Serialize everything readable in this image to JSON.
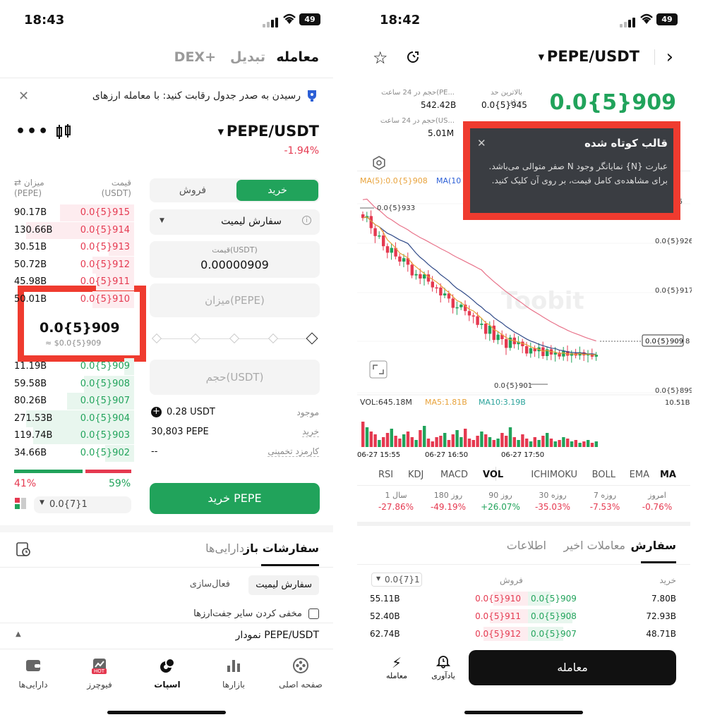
{
  "left": {
    "status_time": "18:43",
    "battery": "49",
    "top_tabs": {
      "trade": "معامله",
      "convert": "تبدیل",
      "dex": "DEX+"
    },
    "banner": "رسیدن به صدر جدول رقابت کنید: با معامله ارزهای",
    "pair": "PEPE/USDT",
    "change": "-1.94%",
    "ob_headers": {
      "price": "قیمت",
      "price_unit": "(USDT)",
      "amount": "میزان",
      "amount_unit": "(PEPE)"
    },
    "asks": [
      {
        "amount": "90.17B",
        "price": "0.0{5}915"
      },
      {
        "amount": "130.66B",
        "price": "0.0{5}914"
      },
      {
        "amount": "30.51B",
        "price": "0.0{5}913"
      },
      {
        "amount": "50.72B",
        "price": "0.0{5}912"
      },
      {
        "amount": "45.98B",
        "price": "0.0{5}911"
      },
      {
        "amount": "50.01B",
        "price": "0.0{5}910"
      }
    ],
    "mid_price": "0.0{5}909",
    "mid_price_usd": "≈ $0.0{5}909",
    "bids": [
      {
        "amount": "11.19B",
        "price": "0.0{5}909"
      },
      {
        "amount": "59.58B",
        "price": "0.0{5}908"
      },
      {
        "amount": "80.26B",
        "price": "0.0{5}907"
      },
      {
        "amount": "271.53B",
        "price": "0.0{5}904"
      },
      {
        "amount": "119.74B",
        "price": "0.0{5}903"
      },
      {
        "amount": "34.66B",
        "price": "0.0{5}902"
      }
    ],
    "buy_pct": "41%",
    "sell_pct": "59%",
    "depth_select": "0.0{7}1",
    "buy_tab": "خرید",
    "sell_tab": "فروش",
    "order_type": "سفارش لیمیت",
    "price_label": "قیمت(USDT)",
    "price_value": "0.00000909",
    "amount_placeholder": "میزان(PEPE)",
    "volume_placeholder": "حجم(USDT)",
    "available_label": "موجود",
    "available_value": "0.28 USDT",
    "buy_label": "خرید",
    "buy_value": "30,803 PEPE",
    "fee_label": "کارمزد تخمینی",
    "fee_value": "--",
    "buy_button": "خرید PEPE",
    "orders_tabs": {
      "open": "سفارشات باز",
      "assets": "دارایی‌ها"
    },
    "filter_limit": "سفارش لیمیت",
    "filter_trigger": "فعال‌سازی",
    "hide_pairs": "مخفی کردن سایر جفت‌ارزها",
    "chart_row": "نمودار PEPE/USDT",
    "bottom_nav": [
      "صفحه اصلی",
      "بازارها",
      "اسپات",
      "فیوچرز",
      "دارایی‌ها"
    ],
    "hot_badge": "HOT"
  },
  "right": {
    "status_time": "18:42",
    "battery": "49",
    "pair": "PEPE/USDT",
    "price": "0.0{5}909",
    "stats": {
      "high_label": "بالاترین حد در...",
      "high_value": "0.0{5}945",
      "vol_pepe_label": "حجم در 24 ساعت(PE...",
      "vol_pepe_value": "542.42B",
      "vol_usdt_label": "حجم در 24 ساعت(US...",
      "vol_usdt_value": "5.01M"
    },
    "tooltip": {
      "title": "قالب کوتاه شده",
      "body": "عبارت {N} نمایانگر وجود N صفر متوالی می‌باشد. برای مشاهده‌ی کامل قیمت، بر روی آن کلیک کنید."
    },
    "ma_legend": {
      "ma5": "MA(5):0.0{5}908",
      "ma10": "MA(10"
    },
    "chart_labels": {
      "y": [
        "935",
        "0.0{5}926",
        "0.0{5}917",
        "0.0{5}899"
      ],
      "last_price": "0.0{5}909",
      "high_marker": "0.0{5}933",
      "low_marker": "0.0{5}901",
      "watermark": "Toobit",
      "times": [
        "06-27 15:55",
        "06-27 16:50",
        "06-27 17:50"
      ]
    },
    "volume_legend": {
      "vol": "VOL:645.18M",
      "ma5": "MA5:1.81B",
      "ma10": "MA10:3.19B",
      "max": "10.51B"
    },
    "indicator_tabs": [
      "MA",
      "EMA",
      "BOLL",
      "ICHIMOKU",
      "VOL",
      "MACD",
      "KDJ",
      "RSI"
    ],
    "periods": [
      {
        "label": "امروز",
        "value": "-0.76%"
      },
      {
        "label": "7 روزه",
        "value": "-7.53%"
      },
      {
        "label": "30 روزه",
        "value": "-35.03%"
      },
      {
        "label": "90 روز",
        "value": "+26.07%"
      },
      {
        "label": "180 روز",
        "value": "-49.19%"
      },
      {
        "label": "1 سال",
        "value": "-27.86%"
      }
    ],
    "detail_tabs": {
      "orders": "سفارش",
      "recent": "معاملات اخیر",
      "info": "اطلاعات"
    },
    "depth_select": "0.0{7}1",
    "book_headers": {
      "buy": "خرید",
      "sell": "فروش"
    },
    "book_rows": [
      {
        "buy_amount": "7.80B",
        "buy_price": "0.0{5}909",
        "sell_price": "0.0{5}910",
        "sell_amount": "55.11B"
      },
      {
        "buy_amount": "72.93B",
        "buy_price": "0.0{5}908",
        "sell_price": "0.0{5}911",
        "sell_amount": "52.40B"
      },
      {
        "buy_amount": "48.71B",
        "buy_price": "0.0{5}907",
        "sell_price": "0.0{5}912",
        "sell_amount": "62.74B"
      }
    ],
    "trade_button": "معامله",
    "alert_label": "یادآوری",
    "trade_icon_label": "معامله"
  }
}
